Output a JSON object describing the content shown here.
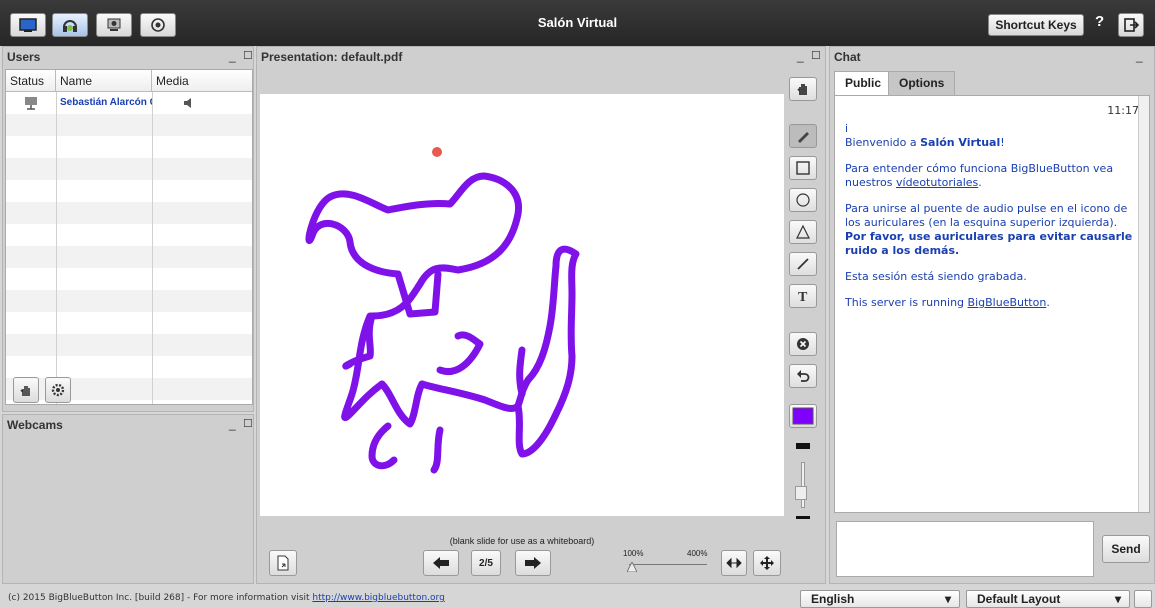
{
  "app": {
    "title": "Salón Virtual",
    "shortcut_label": "Shortcut Keys",
    "help_label": "?"
  },
  "users": {
    "title": "Users",
    "columns": [
      "Status",
      "Name",
      "Media"
    ],
    "rows": [
      {
        "name": "Sebastián Alarcón C"
      }
    ]
  },
  "webcams": {
    "title": "Webcams"
  },
  "presentation": {
    "title": "Presentation: default.pdf",
    "caption": "(blank slide for use as a whiteboard)",
    "page": "2/5",
    "zoom_min": "100%",
    "zoom_max": "400%",
    "pen_color": "#8000ff",
    "stroke_color": "#7f12e8",
    "pointer_color": "#e85a4f"
  },
  "chat": {
    "title": "Chat",
    "tab_public": "Public",
    "tab_options": "Options",
    "time": "11:17",
    "line1": "i",
    "welcome_pre": "Bienvenido a ",
    "welcome_bold": "Salón Virtual",
    "welcome_post": "!",
    "msg2_pre": "Para entender cómo funciona BigBlueButton vea nuestros ",
    "msg2_link": "vídeotutoriales",
    "msg2_post": ".",
    "msg3_pre": "Para unirse al puente de audio pulse en el icono de los auriculares (en la esquina superior izquierda). ",
    "msg3_bold": "Por favor, use auriculares para evitar causarle ruido a los demás.",
    "msg4": "Esta sesión está siendo grabada.",
    "msg5_pre": "This server is running ",
    "msg5_link": "BigBlueButton",
    "msg5_post": ".",
    "send_label": "Send"
  },
  "footer": {
    "copyright": "(c) 2015 BigBlueButton Inc. [build 268] - For more information visit ",
    "link": "http://www.bigbluebutton.org",
    "language": "English",
    "layout": "Default Layout"
  }
}
